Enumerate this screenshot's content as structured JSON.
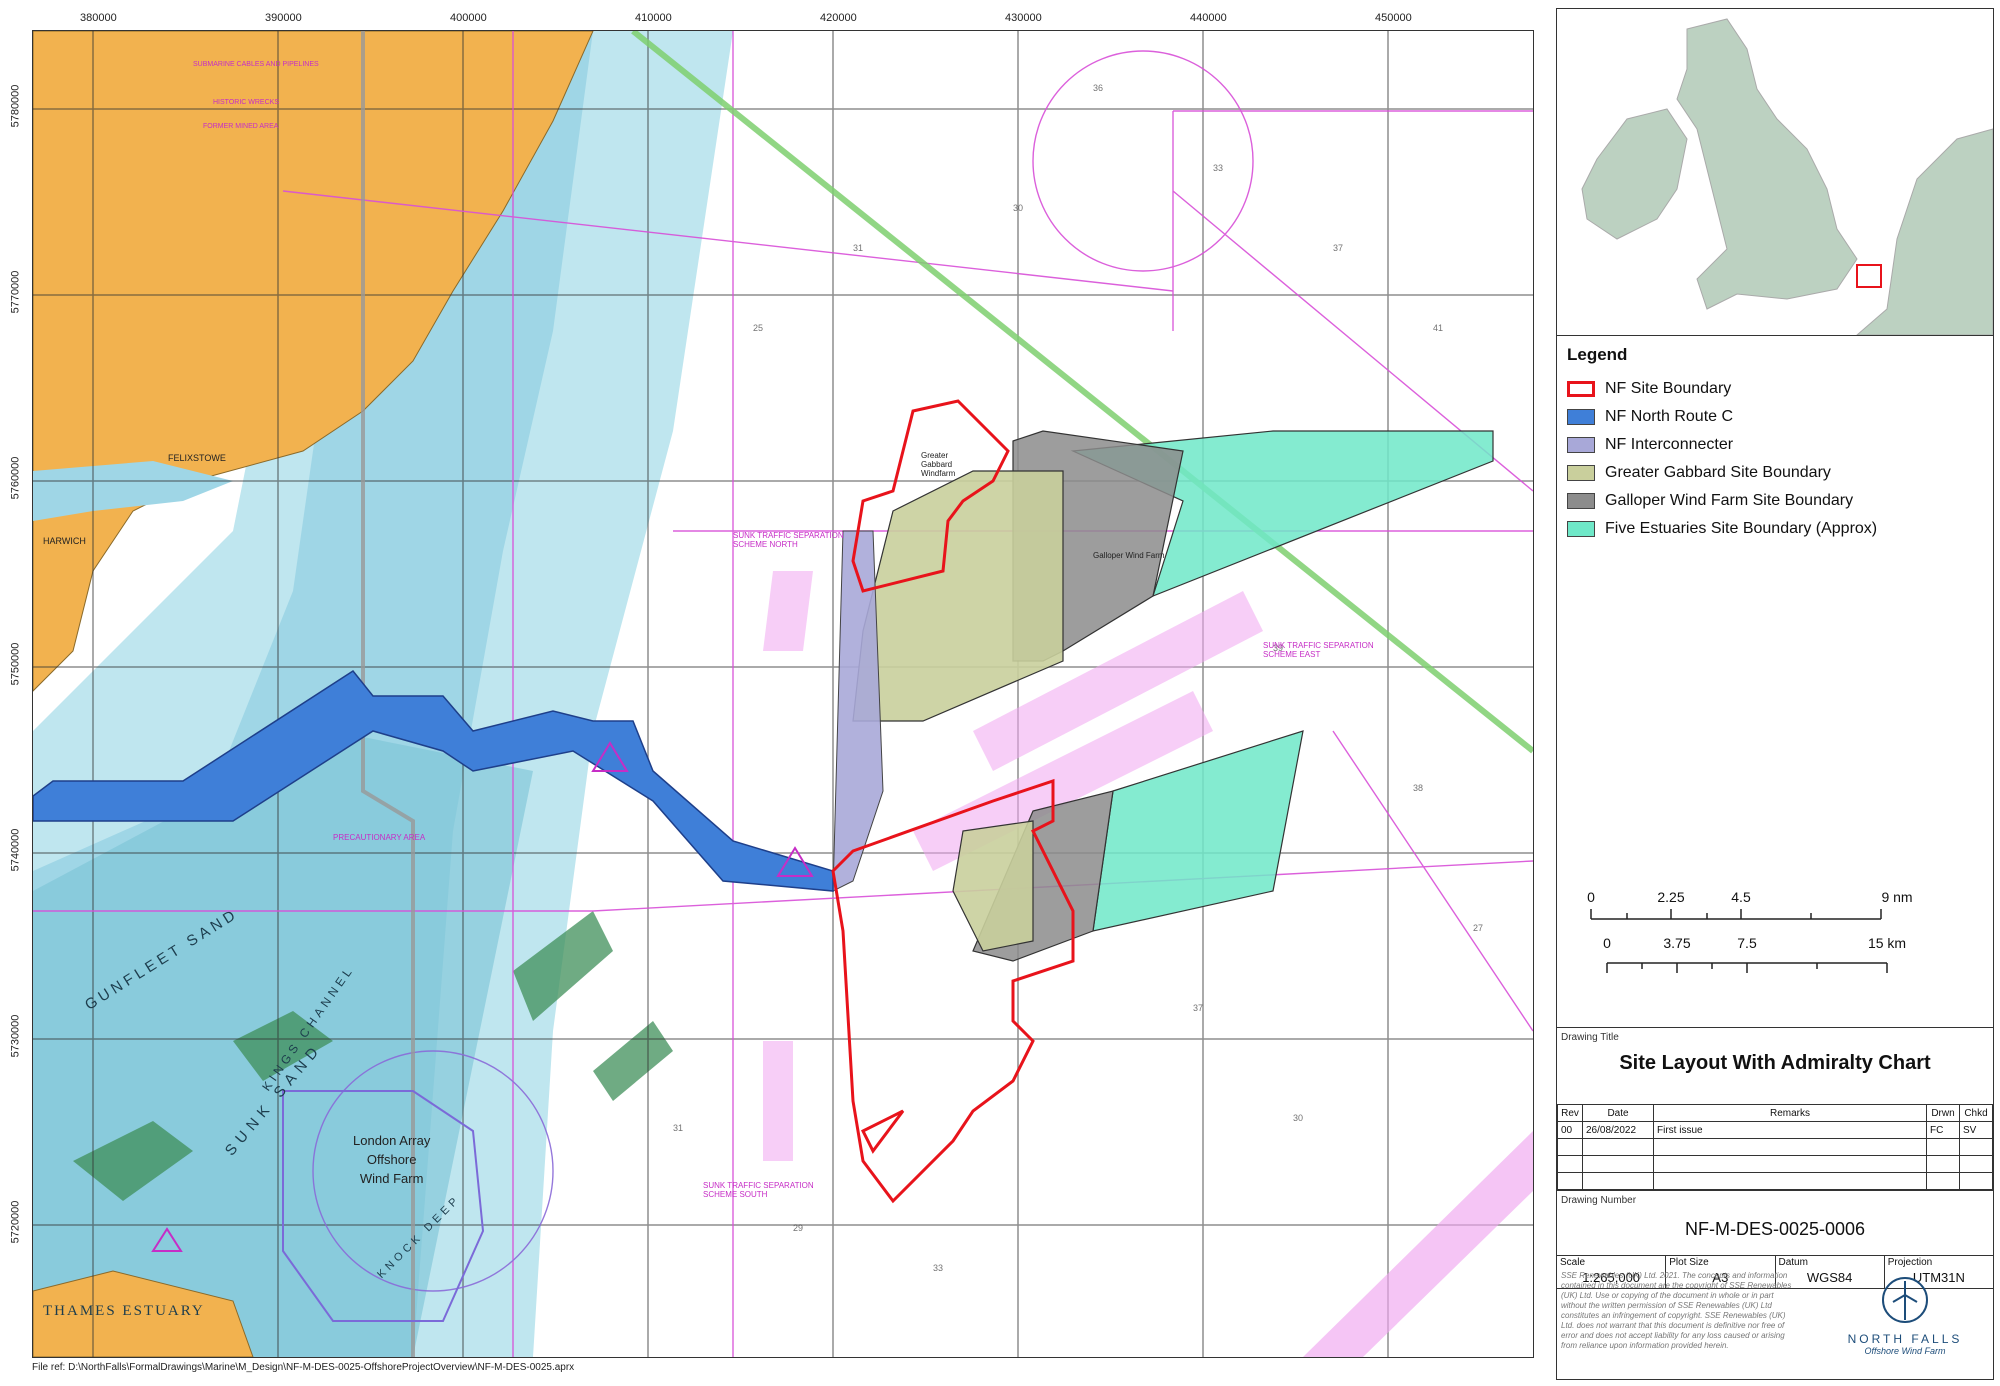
{
  "axes": {
    "eastings": [
      "380000",
      "390000",
      "400000",
      "410000",
      "420000",
      "430000",
      "440000",
      "450000"
    ],
    "northings": [
      "5780000",
      "5770000",
      "5760000",
      "5750000",
      "5740000",
      "5730000",
      "5720000"
    ]
  },
  "map_labels": {
    "harwich": "HARWICH",
    "felixstowe": "FELIXSTOWE",
    "gunfleet": "GUNFLEET SAND",
    "sunk_sand": "SUNK SAND",
    "kings_channel": "KINGS CHANNEL",
    "knock_deep": "KNOCK DEEP",
    "thames_estuary": "THAMES ESTUARY",
    "london_array": "London Array\nOffshore\nWind Farm",
    "precautionary_area": "PRECAUTIONARY AREA",
    "sunk_tss_north": "SUNK TRAFFIC SEPARATION SCHEME NORTH",
    "sunk_tss_east": "SUNK TRAFFIC SEPARATION SCHEME EAST",
    "sunk_tss_south": "SUNK TRAFFIC SEPARATION SCHEME SOUTH",
    "greater_gabbard": "Greater Gabbard Windfarm",
    "galloper": "Galloper Wind Farm",
    "submarine_cables": "SUBMARINE CABLES AND PIPELINES",
    "historic_wrecks": "HISTORIC WRECKS",
    "former_mined_area": "FORMER MINED AREA"
  },
  "file_ref": "File ref: D:\\NorthFalls\\FormalDrawings\\Marine\\M_Design\\NF-M-DES-0025-OffshoreProjectOverview\\NF-M-DES-0025.aprx",
  "legend": {
    "title": "Legend",
    "items": [
      {
        "label": "NF Site Boundary",
        "fill": "#ffffff",
        "stroke": "#e8131b",
        "kind": "outline"
      },
      {
        "label": "NF North Route C",
        "fill": "#3f7fd8",
        "stroke": "#1e3f8a",
        "kind": "fill"
      },
      {
        "label": "NF Interconnecter",
        "fill": "#a8a8d8",
        "stroke": "#555",
        "kind": "fill"
      },
      {
        "label": "Greater Gabbard Site Boundary",
        "fill": "#c9cf9c",
        "stroke": "#444",
        "kind": "fill"
      },
      {
        "label": "Galloper Wind Farm Site Boundary",
        "fill": "#8c8c8c",
        "stroke": "#444",
        "kind": "fill"
      },
      {
        "label": "Five Estuaries Site Boundary (Approx)",
        "fill": "#6fe8c8",
        "stroke": "#444",
        "kind": "fill"
      }
    ]
  },
  "scalebar": {
    "nm": [
      "0",
      "2.25",
      "4.5",
      "9 nm"
    ],
    "km": [
      "0",
      "3.75",
      "7.5",
      "15 km"
    ]
  },
  "title_block": {
    "drawing_title_label": "Drawing Title",
    "drawing_title": "Site Layout With Admiralty Chart",
    "rev_headers": [
      "Rev",
      "Date",
      "Remarks",
      "Drwn",
      "Chkd"
    ],
    "rev_rows": [
      [
        "00",
        "26/08/2022",
        "First issue",
        "FC",
        "SV"
      ],
      [
        "",
        "",
        "",
        "",
        ""
      ],
      [
        "",
        "",
        "",
        "",
        ""
      ],
      [
        "",
        "",
        "",
        "",
        ""
      ]
    ],
    "drawing_number_label": "Drawing Number",
    "drawing_number": "NF-M-DES-0025-0006",
    "meta": [
      {
        "label": "Scale",
        "value": "1:265,000"
      },
      {
        "label": "Plot Size",
        "value": "A3"
      },
      {
        "label": "Datum",
        "value": "WGS84"
      },
      {
        "label": "Projection",
        "value": "UTM31N"
      }
    ],
    "copyright": "SSE Renewables (UK) Ltd. 2021. The concepts and information contained in this document are the copyright of SSE Renewables (UK) Ltd. Use or copying of the document in whole or in part without the written permission of SSE Renewables (UK) Ltd constitutes an infringement of copyright. SSE Renewables (UK) Ltd. does not warrant that this document is definitive nor free of error and does not accept liability for any loss caused or arising from reliance upon information provided herein.",
    "logo_name": "NORTH FALLS",
    "logo_sub": "Offshore Wind Farm"
  }
}
